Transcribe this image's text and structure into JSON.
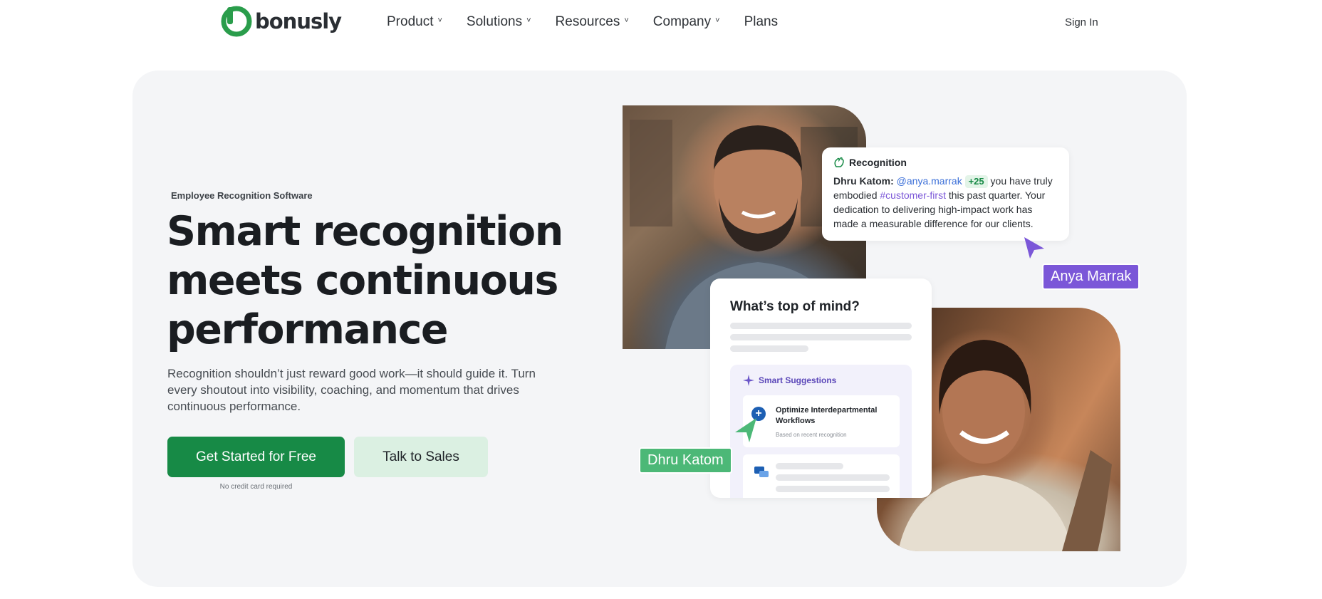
{
  "brand": {
    "name": "bonusly",
    "color": "#2a9d4b"
  },
  "nav": {
    "items": [
      {
        "label": "Product",
        "has_dropdown": true
      },
      {
        "label": "Solutions",
        "has_dropdown": true
      },
      {
        "label": "Resources",
        "has_dropdown": true
      },
      {
        "label": "Company",
        "has_dropdown": true
      },
      {
        "label": "Plans",
        "has_dropdown": false
      }
    ],
    "chevron": "˅",
    "sign_in": "Sign In"
  },
  "hero": {
    "eyebrow": "Employee Recognition Software",
    "headline": "Smart recognition meets continuous performance",
    "subtext": "Recognition shouldn’t just reward good work—it should guide it. Turn every shoutout into visibility, coaching, and momentum that drives continuous performance.",
    "primary_cta": "Get Started for Free",
    "secondary_cta": "Talk to Sales",
    "note": "No credit card required",
    "colors": {
      "primary": "#178a46",
      "secondary": "#dbf0e2",
      "background": "#f4f5f7"
    }
  },
  "recognition_card": {
    "title": "Recognition",
    "author": "Dhru Katom:",
    "mention": "@anya.marrak",
    "points": "+25",
    "text_before_hashtag": "you have truly embodied",
    "hashtag": "#customer-first",
    "text_after_hashtag": "this past quarter. Your dedication to delivering high-impact work has made a measurable difference for our clients."
  },
  "cursor_tags": {
    "anya": {
      "label": "Anya Marrak",
      "color": "#7b57d8"
    },
    "dhru": {
      "label": "Dhru Katom",
      "color": "#4cb877"
    }
  },
  "top_of_mind_card": {
    "title": "What’s top of mind?",
    "smart_suggestions": {
      "title": "Smart Suggestions",
      "items": [
        {
          "title": "Optimize Interdepartmental Workflows",
          "subtitle": "Based on recent recognition",
          "icon": "plus-circle-icon"
        },
        {
          "icon": "chat-bubbles-icon"
        }
      ]
    }
  }
}
